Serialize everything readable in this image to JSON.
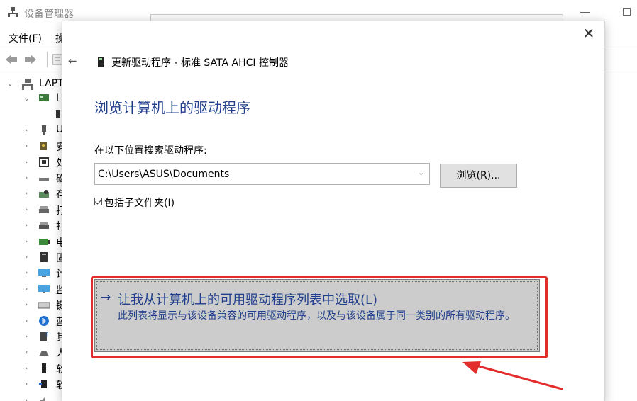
{
  "device_manager": {
    "title": "设备管理器",
    "menu": [
      {
        "label": "文件(F)"
      },
      {
        "label": "操"
      }
    ],
    "tree": {
      "root_label": "LAPT",
      "rows": [
        {
          "label": "I",
          "icon": "storage-controller-icon"
        },
        {
          "label": "",
          "icon": "ide-device-icon"
        },
        {
          "label": "U",
          "icon": "usb-icon"
        },
        {
          "label": "安",
          "icon": "security-device-icon"
        },
        {
          "label": "处",
          "icon": "processor-icon"
        },
        {
          "label": "磁",
          "icon": "disk-drive-icon"
        },
        {
          "label": "存",
          "icon": "storage-icon"
        },
        {
          "label": "打",
          "icon": "print-queue-icon"
        },
        {
          "label": "打",
          "icon": "printer-icon"
        },
        {
          "label": "电",
          "icon": "battery-icon"
        },
        {
          "label": "固",
          "icon": "firmware-icon"
        },
        {
          "label": "计",
          "icon": "computer-icon"
        },
        {
          "label": "监",
          "icon": "monitor-icon"
        },
        {
          "label": "键",
          "icon": "keyboard-icon"
        },
        {
          "label": "蓝",
          "icon": "bluetooth-icon"
        },
        {
          "label": "其",
          "icon": "other-device-icon"
        },
        {
          "label": "人",
          "icon": "hid-icon"
        },
        {
          "label": "软",
          "icon": "software-component-icon"
        },
        {
          "label": "软",
          "icon": "software-device-icon"
        },
        {
          "label": "",
          "icon": "audio-icon"
        }
      ]
    }
  },
  "dialog": {
    "header_title": "更新驱动程序 - 标准 SATA AHCI 控制器",
    "heading": "浏览计算机上的驱动程序",
    "search_label": "在以下位置搜索驱动程序:",
    "path_value": "C:\\Users\\ASUS\\Documents",
    "browse_label": "浏览(R)...",
    "include_subfolders_label": "包括子文件夹(I)",
    "include_subfolders_checked": true,
    "pick_option": {
      "arrow": "→",
      "title": "让我从计算机上的可用驱动程序列表中选取(L)",
      "description": "此列表将显示与该设备兼容的可用驱动程序，以及与该设备属于同一类别的所有驱动程序。"
    },
    "close_glyph": "✕",
    "back_glyph": "←"
  },
  "colors": {
    "heading_blue": "#1f3e8c",
    "highlight_red": "#e32c2c",
    "option_gray": "#cccccc"
  }
}
